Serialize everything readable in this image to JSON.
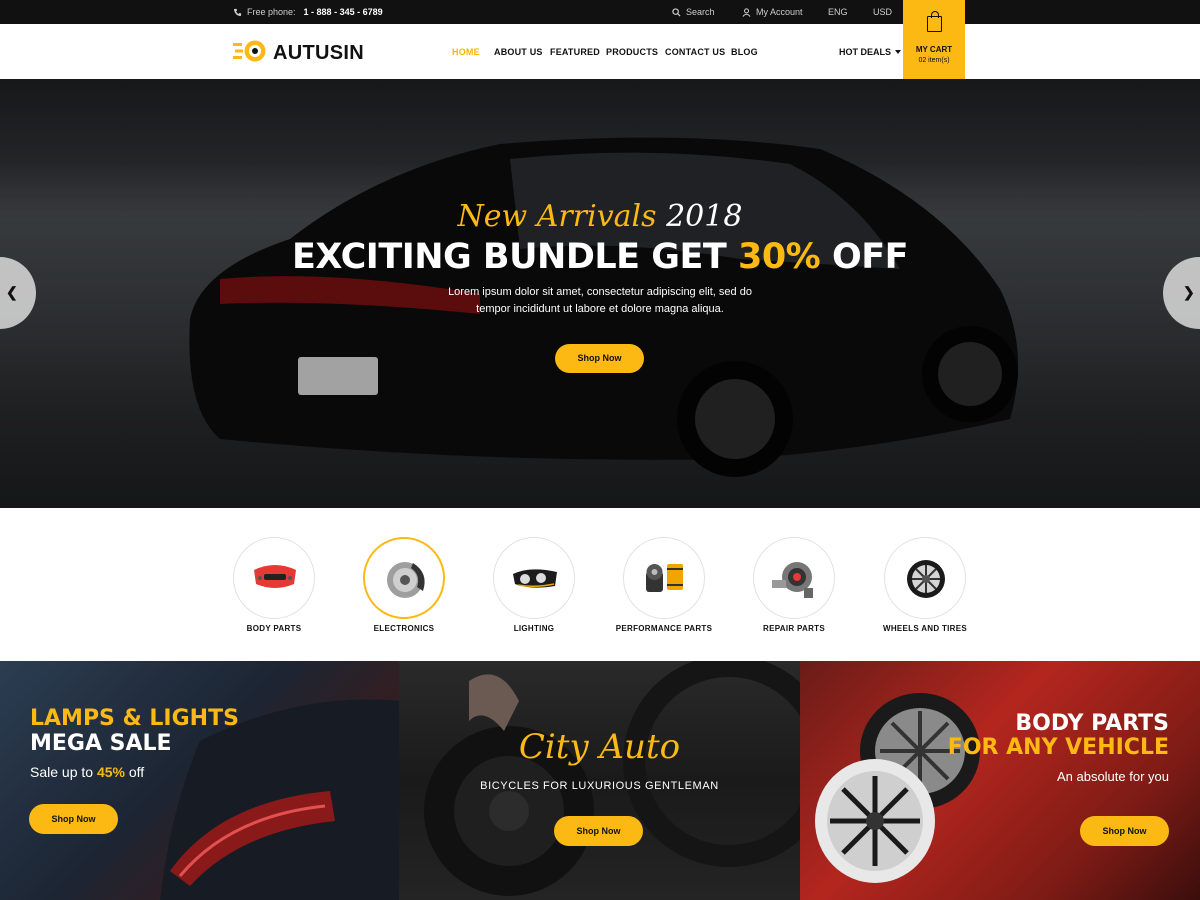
{
  "topbar": {
    "phone_label": "Free phone:",
    "phone_number": "1 - 888 - 345 - 6789",
    "search": "Search",
    "account": "My Account",
    "language": "ENG",
    "currency": "USD"
  },
  "header": {
    "logo": "AUTUSIN",
    "nav": [
      "HOME",
      "ABOUT US",
      "FEATURED",
      "PRODUCTS",
      "CONTACT US",
      "BLOG"
    ],
    "hot_deals": "HOT DEALS",
    "cart_label": "MY CART",
    "cart_count": "02 item(s)"
  },
  "hero": {
    "subtitle_main": "New Arrivals",
    "subtitle_year": "2018",
    "title_pre": "EXCITING BUNDLE GET",
    "title_accent": "30%",
    "title_post": "OFF",
    "text_line1": "Lorem ipsum dolor sit amet, consectetur adipiscing elit, sed do",
    "text_line2": "tempor incididunt ut labore et dolore magna aliqua.",
    "button": "Shop Now"
  },
  "categories": [
    {
      "label": "BODY PARTS",
      "icon": "bumper-icon"
    },
    {
      "label": "ELECTRONICS",
      "icon": "brake-disc-icon"
    },
    {
      "label": "LIGHTING",
      "icon": "headlight-icon"
    },
    {
      "label": "PERFORMANCE PARTS",
      "icon": "oil-filter-icon"
    },
    {
      "label": "REPAIR PARTS",
      "icon": "turbo-icon"
    },
    {
      "label": "WHEELS AND TIRES",
      "icon": "wheel-icon"
    }
  ],
  "banners": {
    "b1": {
      "line1": "LAMPS & LIGHTS",
      "line2": "MEGA SALE",
      "sale_pre": "Sale up to",
      "sale_accent": "45%",
      "sale_post": "off",
      "button": "Shop Now"
    },
    "b2": {
      "title": "City Auto",
      "subtitle": "BICYCLES FOR LUXURIOUS GENTLEMAN",
      "button": "Shop Now"
    },
    "b3": {
      "line1": "BODY PARTS",
      "line2": "FOR ANY VEHICLE",
      "line3": "An absolute for you",
      "button": "Shop Now"
    }
  },
  "colors": {
    "accent": "#fcb913",
    "dark": "#111111"
  }
}
